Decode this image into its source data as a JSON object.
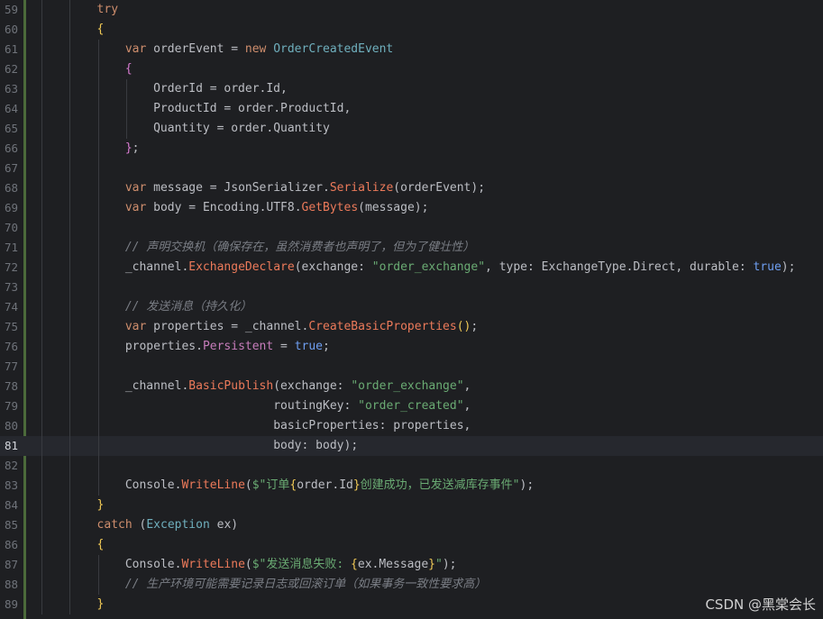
{
  "editor": {
    "lines": [
      {
        "num": "59",
        "indent": 2,
        "tokens": [
          [
            "kw",
            "try"
          ]
        ]
      },
      {
        "num": "60",
        "indent": 2,
        "tokens": [
          [
            "br1",
            "{"
          ]
        ]
      },
      {
        "num": "61",
        "indent": 3,
        "tokens": [
          [
            "kw",
            "var"
          ],
          [
            "lv",
            " orderEvent "
          ],
          [
            "pn",
            "= "
          ],
          [
            "kw",
            "new "
          ],
          [
            "tp",
            "OrderCreatedEvent"
          ]
        ]
      },
      {
        "num": "62",
        "indent": 3,
        "tokens": [
          [
            "br2",
            "{"
          ]
        ]
      },
      {
        "num": "63",
        "indent": 4,
        "tokens": [
          [
            "lv",
            "OrderId "
          ],
          [
            "pn",
            "= "
          ],
          [
            "lv",
            "order"
          ],
          [
            "pn",
            "."
          ],
          [
            "lv",
            "Id"
          ],
          [
            "pn",
            ","
          ]
        ]
      },
      {
        "num": "64",
        "indent": 4,
        "tokens": [
          [
            "lv",
            "ProductId "
          ],
          [
            "pn",
            "= "
          ],
          [
            "lv",
            "order"
          ],
          [
            "pn",
            "."
          ],
          [
            "lv",
            "ProductId"
          ],
          [
            "pn",
            ","
          ]
        ]
      },
      {
        "num": "65",
        "indent": 4,
        "tokens": [
          [
            "lv",
            "Quantity "
          ],
          [
            "pn",
            "= "
          ],
          [
            "lv",
            "order"
          ],
          [
            "pn",
            "."
          ],
          [
            "lv",
            "Quantity"
          ]
        ]
      },
      {
        "num": "66",
        "indent": 3,
        "tokens": [
          [
            "br2",
            "}"
          ],
          [
            "pn",
            ";"
          ]
        ]
      },
      {
        "num": "67",
        "indent": 3,
        "tokens": []
      },
      {
        "num": "68",
        "indent": 3,
        "tokens": [
          [
            "kw",
            "var"
          ],
          [
            "lv",
            " message "
          ],
          [
            "pn",
            "= "
          ],
          [
            "lv",
            "JsonSerializer"
          ],
          [
            "pn",
            "."
          ],
          [
            "mc",
            "Serialize"
          ],
          [
            "pn",
            "("
          ],
          [
            "lv",
            "orderEvent"
          ],
          [
            "pn",
            ");"
          ]
        ]
      },
      {
        "num": "69",
        "indent": 3,
        "tokens": [
          [
            "kw",
            "var"
          ],
          [
            "lv",
            " body "
          ],
          [
            "pn",
            "= "
          ],
          [
            "lv",
            "Encoding"
          ],
          [
            "pn",
            "."
          ],
          [
            "lv",
            "UTF8"
          ],
          [
            "pn",
            "."
          ],
          [
            "mc",
            "GetBytes"
          ],
          [
            "pn",
            "("
          ],
          [
            "lv",
            "message"
          ],
          [
            "pn",
            ");"
          ]
        ]
      },
      {
        "num": "70",
        "indent": 3,
        "tokens": []
      },
      {
        "num": "71",
        "indent": 3,
        "tokens": [
          [
            "cm",
            "// 声明交换机（确保存在，虽然消费者也声明了，但为了健壮性）"
          ]
        ]
      },
      {
        "num": "72",
        "indent": 3,
        "tokens": [
          [
            "lv",
            "_channel"
          ],
          [
            "pn",
            "."
          ],
          [
            "mc",
            "ExchangeDeclare"
          ],
          [
            "pn",
            "("
          ],
          [
            "lv",
            "exchange"
          ],
          [
            "pn",
            ": "
          ],
          [
            "st",
            "\"order_exchange\""
          ],
          [
            "pn",
            ", "
          ],
          [
            "lv",
            "type"
          ],
          [
            "pn",
            ": "
          ],
          [
            "lv",
            "ExchangeType"
          ],
          [
            "pn",
            "."
          ],
          [
            "lv",
            "Direct"
          ],
          [
            "pn",
            ", "
          ],
          [
            "lv",
            "durable"
          ],
          [
            "pn",
            ": "
          ],
          [
            "kwb",
            "true"
          ],
          [
            "pn",
            ");"
          ]
        ]
      },
      {
        "num": "73",
        "indent": 3,
        "tokens": []
      },
      {
        "num": "74",
        "indent": 3,
        "tokens": [
          [
            "cm",
            "// 发送消息（持久化）"
          ]
        ]
      },
      {
        "num": "75",
        "indent": 3,
        "tokens": [
          [
            "kw",
            "var"
          ],
          [
            "lv",
            " properties "
          ],
          [
            "pn",
            "= "
          ],
          [
            "lv",
            "_channel"
          ],
          [
            "pn",
            "."
          ],
          [
            "mc",
            "CreateBasicProperties"
          ],
          [
            "br1",
            "()"
          ],
          [
            "pn",
            ";"
          ]
        ]
      },
      {
        "num": "76",
        "indent": 3,
        "tokens": [
          [
            "lv",
            "properties"
          ],
          [
            "pn",
            "."
          ],
          [
            "pr",
            "Persistent"
          ],
          [
            "pn",
            " = "
          ],
          [
            "kwb",
            "true"
          ],
          [
            "pn",
            ";"
          ]
        ]
      },
      {
        "num": "77",
        "indent": 3,
        "tokens": []
      },
      {
        "num": "78",
        "indent": 3,
        "tokens": [
          [
            "lv",
            "_channel"
          ],
          [
            "pn",
            "."
          ],
          [
            "mc",
            "BasicPublish"
          ],
          [
            "pn",
            "("
          ],
          [
            "lv",
            "exchange"
          ],
          [
            "pn",
            ": "
          ],
          [
            "st",
            "\"order_exchange\""
          ],
          [
            "pn",
            ","
          ]
        ]
      },
      {
        "num": "79",
        "indent": 3,
        "pad": "                     ",
        "tokens": [
          [
            "lv",
            "routingKey"
          ],
          [
            "pn",
            ": "
          ],
          [
            "st",
            "\"order_created\""
          ],
          [
            "pn",
            ","
          ]
        ]
      },
      {
        "num": "80",
        "indent": 3,
        "pad": "                     ",
        "tokens": [
          [
            "lv",
            "basicProperties"
          ],
          [
            "pn",
            ": "
          ],
          [
            "lv",
            "properties"
          ],
          [
            "pn",
            ","
          ]
        ]
      },
      {
        "num": "81",
        "indent": 3,
        "pad": "                     ",
        "current": true,
        "tokens": [
          [
            "lv",
            "body"
          ],
          [
            "pn",
            ": "
          ],
          [
            "lv",
            "body"
          ],
          [
            "pn",
            ")"
          ],
          [
            "pn",
            ";"
          ]
        ]
      },
      {
        "num": "82",
        "indent": 3,
        "tokens": []
      },
      {
        "num": "83",
        "indent": 3,
        "tokens": [
          [
            "lv",
            "Console"
          ],
          [
            "pn",
            "."
          ],
          [
            "mc",
            "WriteLine"
          ],
          [
            "pn",
            "("
          ],
          [
            "st",
            "$\"订单"
          ],
          [
            "br1",
            "{"
          ],
          [
            "lv",
            "order"
          ],
          [
            "pn",
            "."
          ],
          [
            "lv",
            "Id"
          ],
          [
            "br1",
            "}"
          ],
          [
            "st",
            "创建成功，已发送减库存事件\""
          ],
          [
            "pn",
            ");"
          ]
        ]
      },
      {
        "num": "84",
        "indent": 2,
        "tokens": [
          [
            "br1",
            "}"
          ]
        ]
      },
      {
        "num": "85",
        "indent": 2,
        "tokens": [
          [
            "kw",
            "catch "
          ],
          [
            "pn",
            "("
          ],
          [
            "tp",
            "Exception"
          ],
          [
            "lv",
            " ex"
          ],
          [
            "pn",
            ")"
          ]
        ]
      },
      {
        "num": "86",
        "indent": 2,
        "tokens": [
          [
            "br1",
            "{"
          ]
        ]
      },
      {
        "num": "87",
        "indent": 3,
        "tokens": [
          [
            "lv",
            "Console"
          ],
          [
            "pn",
            "."
          ],
          [
            "mc",
            "WriteLine"
          ],
          [
            "pn",
            "("
          ],
          [
            "st",
            "$\"发送消息失败: "
          ],
          [
            "br1",
            "{"
          ],
          [
            "lv",
            "ex"
          ],
          [
            "pn",
            "."
          ],
          [
            "lv",
            "Message"
          ],
          [
            "br1",
            "}"
          ],
          [
            "st",
            "\""
          ],
          [
            "pn",
            ");"
          ]
        ]
      },
      {
        "num": "88",
        "indent": 3,
        "tokens": [
          [
            "cm",
            "// 生产环境可能需要记录日志或回滚订单（如果事务一致性要求高）"
          ]
        ]
      },
      {
        "num": "89",
        "indent": 2,
        "tokens": [
          [
            "br1",
            "}"
          ]
        ]
      }
    ]
  },
  "watermark": "CSDN @黑棠会长"
}
